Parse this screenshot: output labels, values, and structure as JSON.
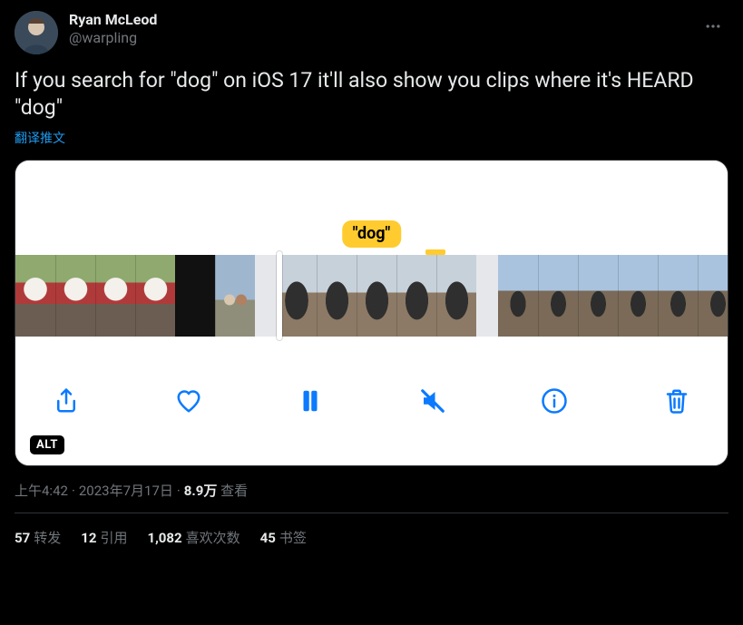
{
  "user": {
    "display_name": "Ryan McLeod",
    "handle": "@warpling"
  },
  "tweet": {
    "text": "If you search for \"dog\" on iOS 17 it'll also show you clips where it's HEARD \"dog\"",
    "translate_label": "翻译推文"
  },
  "media": {
    "tag_label": "\"dog\"",
    "alt_badge": "ALT",
    "icons": {
      "share": "share-icon",
      "heart": "heart-icon",
      "pause": "pause-icon",
      "mute": "mute-icon",
      "info": "info-icon",
      "trash": "trash-icon"
    }
  },
  "meta": {
    "time": "上午4:42",
    "date": "2023年7月17日",
    "views_number": "8.9万",
    "views_label": "查看"
  },
  "stats": {
    "retweets_num": "57",
    "retweets_label": "转发",
    "quotes_num": "12",
    "quotes_label": "引用",
    "likes_num": "1,082",
    "likes_label": "喜欢次数",
    "bookmarks_num": "45",
    "bookmarks_label": "书签"
  }
}
